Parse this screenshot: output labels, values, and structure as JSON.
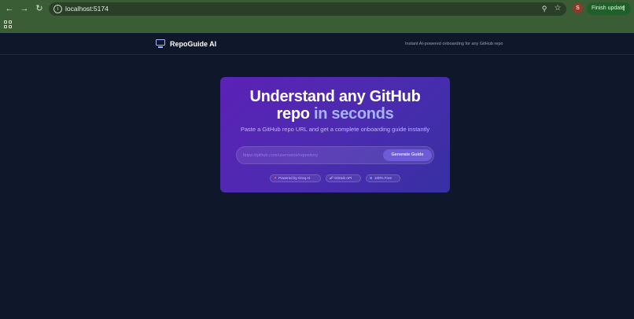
{
  "browser": {
    "url": "localhost:5174",
    "profile_initial": "S",
    "finish_update_label": "Finish update",
    "icons": {
      "back": "arrow-left-icon",
      "forward": "arrow-right-icon",
      "reload": "reload-icon",
      "site_info": "info-icon",
      "zoom": "zoom-icon",
      "bookmark": "star-icon",
      "menu": "kebab-menu-icon",
      "apps": "apps-grid-icon"
    }
  },
  "header": {
    "brand": "RepoGuide AI",
    "tagline": "Instant AI-powered onboarding for any GitHub repo",
    "logo_icon": "monitor-icon"
  },
  "hero": {
    "title_line1": "Understand any GitHub",
    "title_line2_plain": "repo",
    "title_line2_accent": "in seconds",
    "subtitle": "Paste a GitHub repo URL and get a complete onboarding guide instantly",
    "input_placeholder": "https://github.com/username/repository",
    "input_value": "",
    "button_label": "Generate Guide",
    "badges": [
      {
        "label": "Powered by Groq AI",
        "icon": "sparkle-icon"
      },
      {
        "label": "GitHub API",
        "icon": "link-icon"
      },
      {
        "label": "100% Free",
        "icon": "tag-icon"
      }
    ]
  },
  "colors": {
    "page_bg": "#0f172a",
    "card_gradient_start": "#5b21b6",
    "card_gradient_end": "#3730a3",
    "accent": "#a5b4fc",
    "button": "#6d5bd8",
    "chrome": "#3b5d36"
  }
}
